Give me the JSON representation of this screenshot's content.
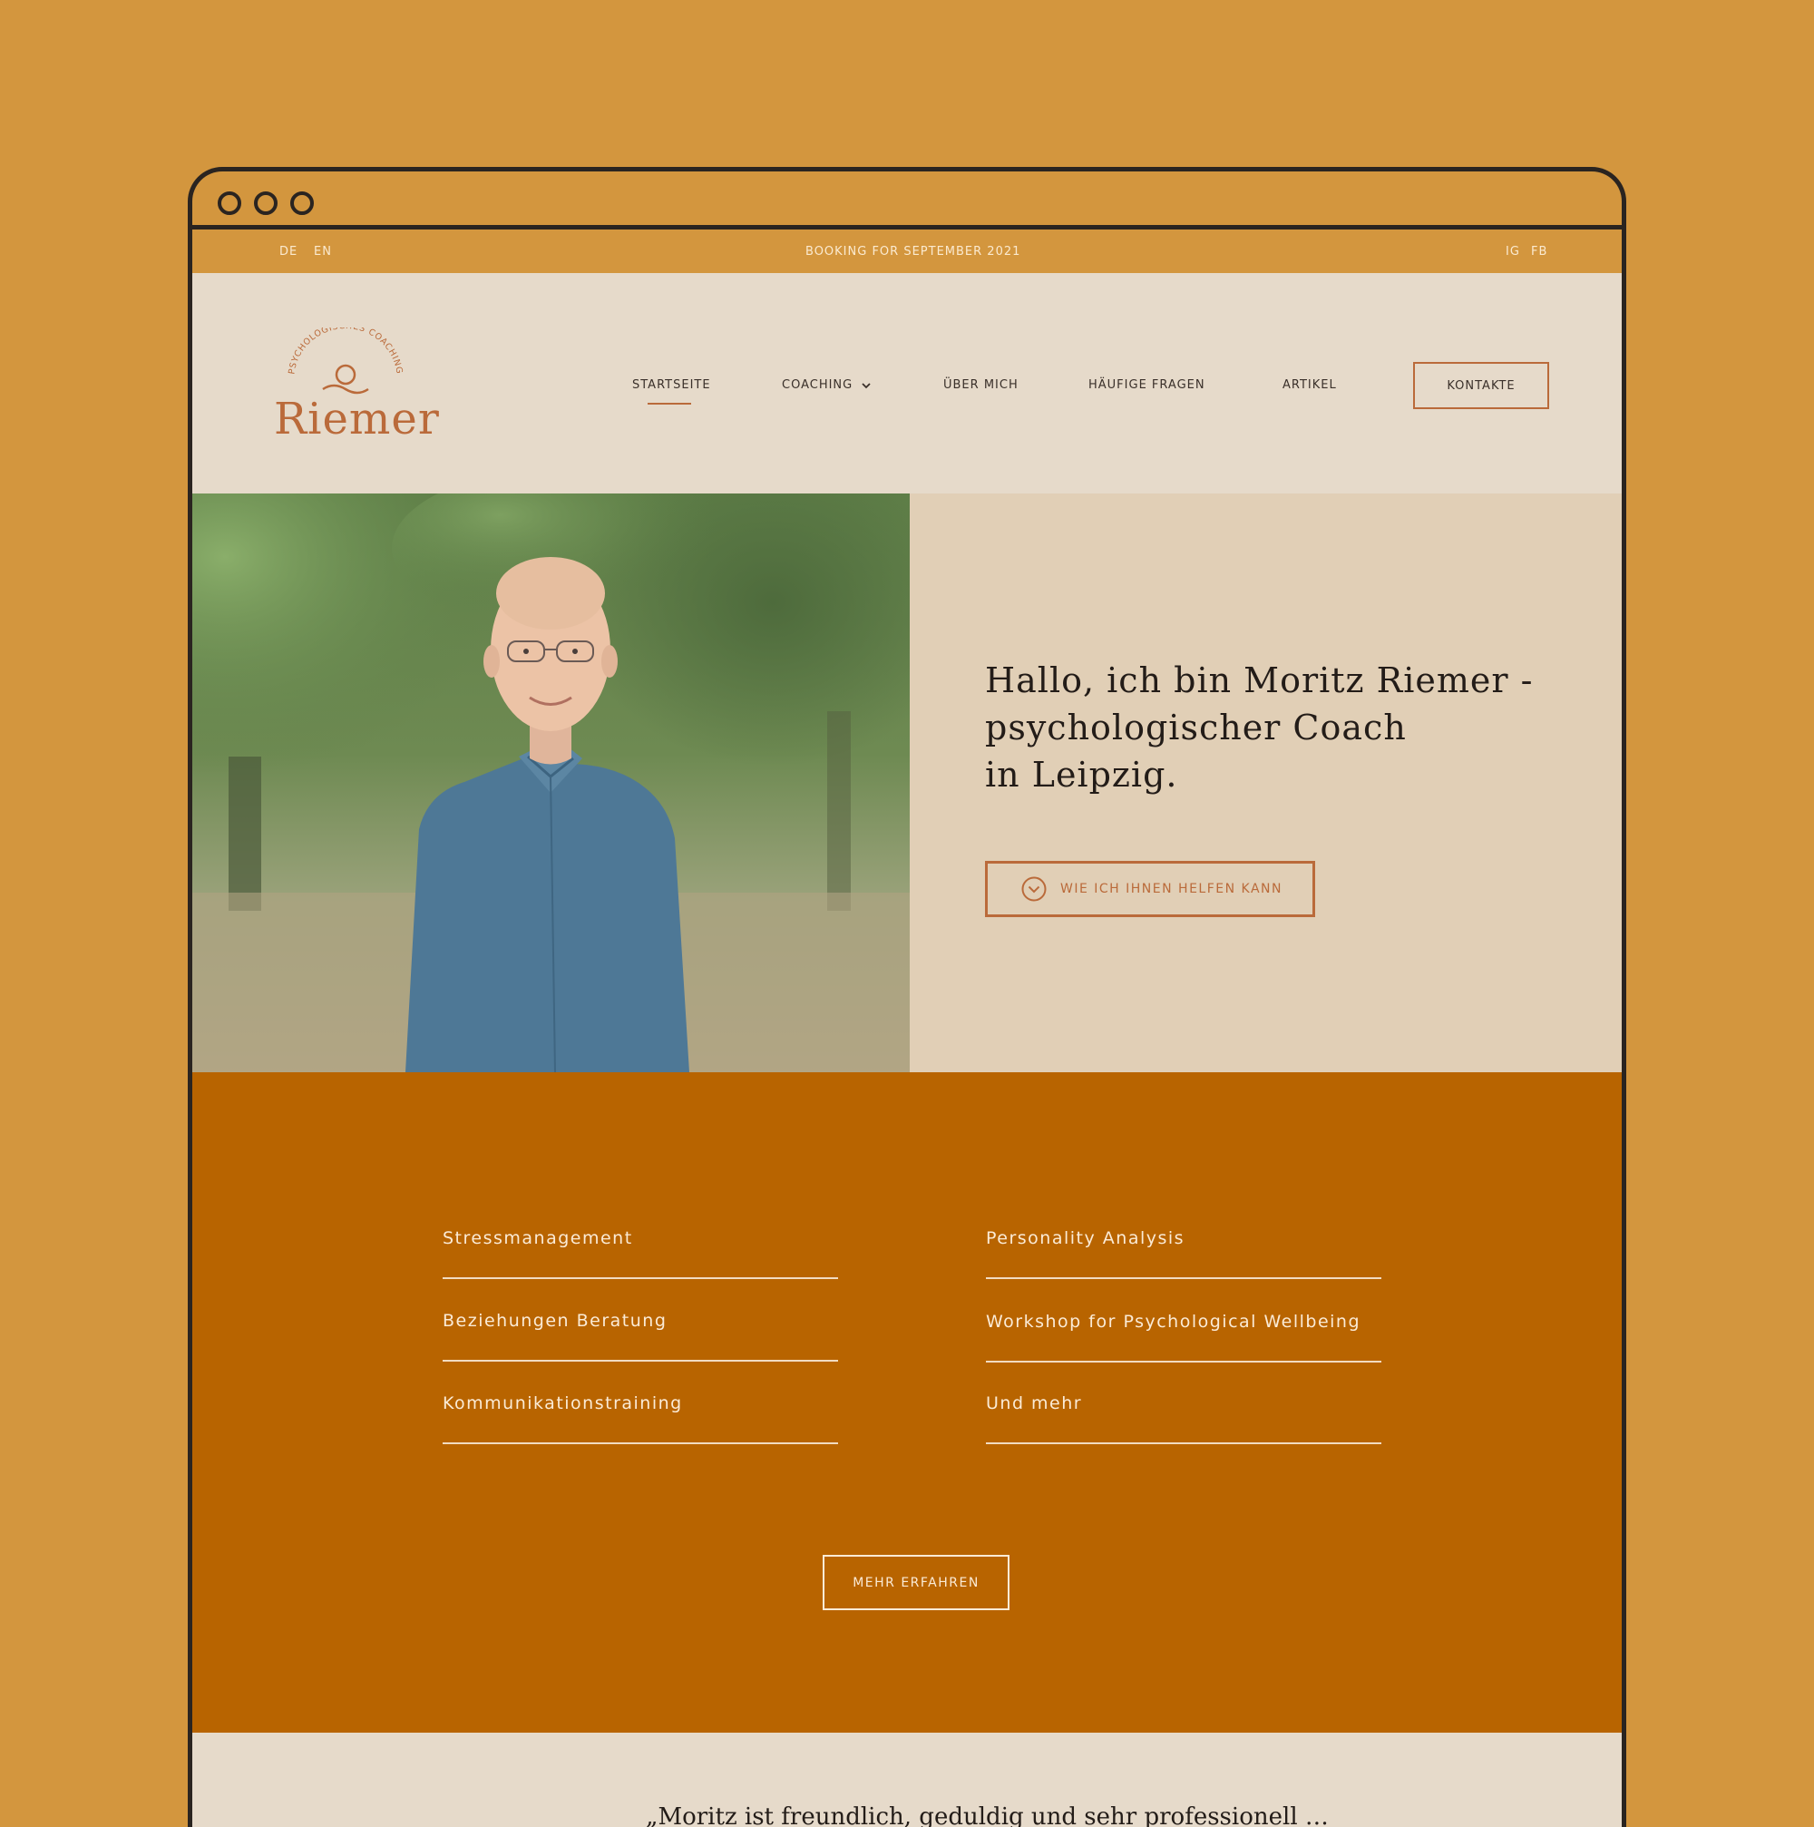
{
  "topbar": {
    "lang_de": "DE",
    "lang_en": "EN",
    "announcement": "BOOKING FOR SEPTEMBER 2021",
    "social_ig": "IG",
    "social_fb": "FB"
  },
  "logo": {
    "tagline": "PSYCHOLOGISCHES COACHING",
    "wordmark": "Riemer"
  },
  "nav": {
    "items": [
      "STARTSEITE",
      "COACHING",
      "ÜBER MICH",
      "HÄUFIGE FRAGEN",
      "ARTIKEL"
    ],
    "cta": "KONTAKTE"
  },
  "hero": {
    "title_line1": "Hallo, ich bin Moritz Riemer -",
    "title_line2": "psychologischer Coach",
    "title_line3": "in Leipzig.",
    "button": "WIE ICH IHNEN HELFEN KANN"
  },
  "services": {
    "left": [
      "Stressmanagement",
      "Beziehungen Beratung",
      "Kommunikationstraining"
    ],
    "right": [
      "Personality Analysis",
      "Workshop for Psychological Wellbeing",
      "Und mehr"
    ],
    "button": "MEHR ERFAHREN"
  },
  "testimonial": {
    "quote_start": "„Moritz ist freundlich, geduldig und sehr professionell …"
  },
  "colors": {
    "background": "#D3963E",
    "cream": "#E6DACA",
    "accent": "#BA6A3A",
    "rust": "#B86400"
  }
}
